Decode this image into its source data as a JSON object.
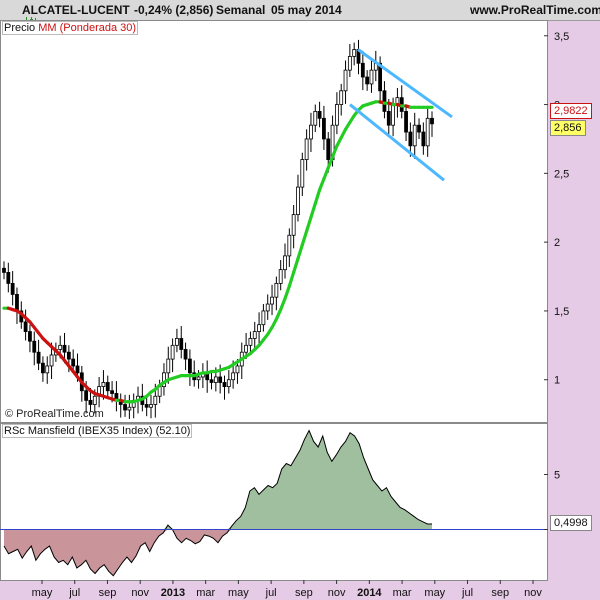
{
  "header": {
    "title": "ALCATEL-LUCENT",
    "change": "-0,24% (2,856)",
    "period": "Semanal",
    "date": "05 may 2014",
    "site": "www.ProRealTime.com"
  },
  "main_panel": {
    "legend_price": "Precio",
    "legend_ma": "MM (Ponderada 30)",
    "ma_badge": "2,9822",
    "price_badge": "2,856",
    "copyright": "© ProRealTime.com"
  },
  "sub_panel": {
    "legend": "RSc Mansfield (IBEX35 Index) (52.10)",
    "value_badge": "0,4998"
  },
  "colors": {
    "ma_up": "#22cc22",
    "ma_down": "#cc1111",
    "channel": "#4db8ff",
    "area_pos": "#9fbf9f",
    "area_neg": "#c9959a",
    "candle_up": "#ffffff",
    "candle_down": "#000000",
    "price_badge_bg": "#ffff66",
    "ma_badge_color": "#cc1111"
  },
  "chart_data": [
    {
      "type": "candlestick",
      "y_axis_ticks": [
        "3,5",
        "3",
        "2,5",
        "2",
        "1,5",
        "1"
      ],
      "ylim": [
        0.7,
        3.6
      ],
      "x_tick_labels": [
        "may",
        "jul",
        "sep",
        "nov",
        "2013",
        "mar",
        "may",
        "jul",
        "sep",
        "nov",
        "2014",
        "mar",
        "may",
        "jul",
        "sep",
        "nov"
      ],
      "close_series": [
        1.78,
        1.7,
        1.62,
        1.5,
        1.42,
        1.35,
        1.28,
        1.2,
        1.12,
        1.05,
        1.1,
        1.18,
        1.22,
        1.25,
        1.2,
        1.15,
        1.1,
        1.05,
        0.92,
        0.85,
        0.82,
        0.88,
        0.95,
        0.98,
        0.92,
        0.9,
        0.85,
        0.82,
        0.78,
        0.8,
        0.85,
        0.88,
        0.82,
        0.8,
        0.82,
        0.88,
        0.95,
        1.05,
        1.15,
        1.25,
        1.3,
        1.22,
        1.15,
        1.05,
        1.0,
        1.02,
        1.05,
        1.0,
        0.98,
        1.02,
        0.98,
        0.95,
        1.0,
        1.05,
        1.1,
        1.2,
        1.25,
        1.3,
        1.35,
        1.4,
        1.5,
        1.55,
        1.6,
        1.7,
        1.8,
        1.9,
        2.05,
        2.2,
        2.4,
        2.6,
        2.75,
        2.85,
        2.95,
        2.9,
        2.75,
        2.6,
        2.85,
        3.0,
        3.1,
        3.25,
        3.35,
        3.4,
        3.3,
        3.2,
        3.15,
        3.25,
        3.3,
        3.1,
        2.95,
        2.85,
        3.0,
        3.05,
        2.95,
        2.8,
        2.7,
        2.85,
        2.8,
        2.7,
        2.9,
        2.86
      ],
      "ma_series": [
        1.52,
        1.52,
        1.51,
        1.5,
        1.48,
        1.45,
        1.42,
        1.38,
        1.34,
        1.3,
        1.27,
        1.24,
        1.21,
        1.18,
        1.14,
        1.1,
        1.06,
        1.02,
        0.98,
        0.95,
        0.92,
        0.9,
        0.89,
        0.88,
        0.87,
        0.86,
        0.85,
        0.85,
        0.84,
        0.84,
        0.84,
        0.85,
        0.86,
        0.88,
        0.91,
        0.93,
        0.96,
        0.98,
        1.0,
        1.01,
        1.02,
        1.03,
        1.03,
        1.03,
        1.03,
        1.04,
        1.05,
        1.05,
        1.06,
        1.06,
        1.07,
        1.08,
        1.09,
        1.11,
        1.13,
        1.15,
        1.17,
        1.19,
        1.22,
        1.25,
        1.29,
        1.33,
        1.38,
        1.44,
        1.51,
        1.59,
        1.68,
        1.78,
        1.88,
        1.98,
        2.08,
        2.18,
        2.28,
        2.38,
        2.46,
        2.54,
        2.62,
        2.7,
        2.76,
        2.82,
        2.87,
        2.92,
        2.96,
        2.99,
        3.0,
        3.01,
        3.02,
        3.02,
        3.01,
        3.01,
        3.0,
        3.0,
        2.99,
        2.99,
        2.98,
        2.98,
        2.98,
        2.98,
        2.98,
        2.98
      ],
      "channel_upper": [
        [
          3.4,
          3.38
        ],
        [
          3.02,
          2.91
        ]
      ],
      "channel_lower": [
        [
          3.0,
          2.95
        ],
        [
          2.5,
          2.45
        ]
      ]
    },
    {
      "type": "area",
      "y_axis_ticks": [
        "5",
        "0"
      ],
      "ylim": [
        -4.5,
        9.5
      ],
      "values": [
        -1.5,
        -2.2,
        -2.0,
        -1.8,
        -2.6,
        -2.0,
        -1.5,
        -2.8,
        -2.2,
        -1.8,
        -1.5,
        -2.5,
        -3.0,
        -2.8,
        -3.2,
        -2.5,
        -3.5,
        -3.2,
        -2.8,
        -3.6,
        -4.0,
        -3.5,
        -3.2,
        -3.8,
        -4.2,
        -3.6,
        -3.0,
        -2.5,
        -3.0,
        -2.4,
        -1.5,
        -1.2,
        -2.0,
        -1.2,
        -0.6,
        -0.3,
        0.4,
        0.0,
        -0.8,
        -1.2,
        -0.8,
        -1.0,
        -1.3,
        -1.1,
        -0.5,
        -0.6,
        -0.8,
        -1.2,
        -0.6,
        -0.3,
        0.3,
        0.8,
        1.2,
        2.0,
        3.5,
        3.8,
        3.2,
        3.6,
        4.0,
        3.8,
        4.2,
        5.5,
        6.0,
        5.8,
        6.5,
        7.2,
        8.2,
        9.0,
        8.0,
        7.5,
        8.5,
        7.0,
        6.2,
        6.8,
        7.5,
        8.0,
        8.8,
        8.5,
        7.8,
        6.5,
        5.5,
        4.5,
        4.0,
        3.5,
        3.8,
        3.0,
        2.5,
        2.0,
        1.8,
        1.5,
        1.2,
        0.9,
        0.7,
        0.5,
        0.5
      ]
    }
  ]
}
